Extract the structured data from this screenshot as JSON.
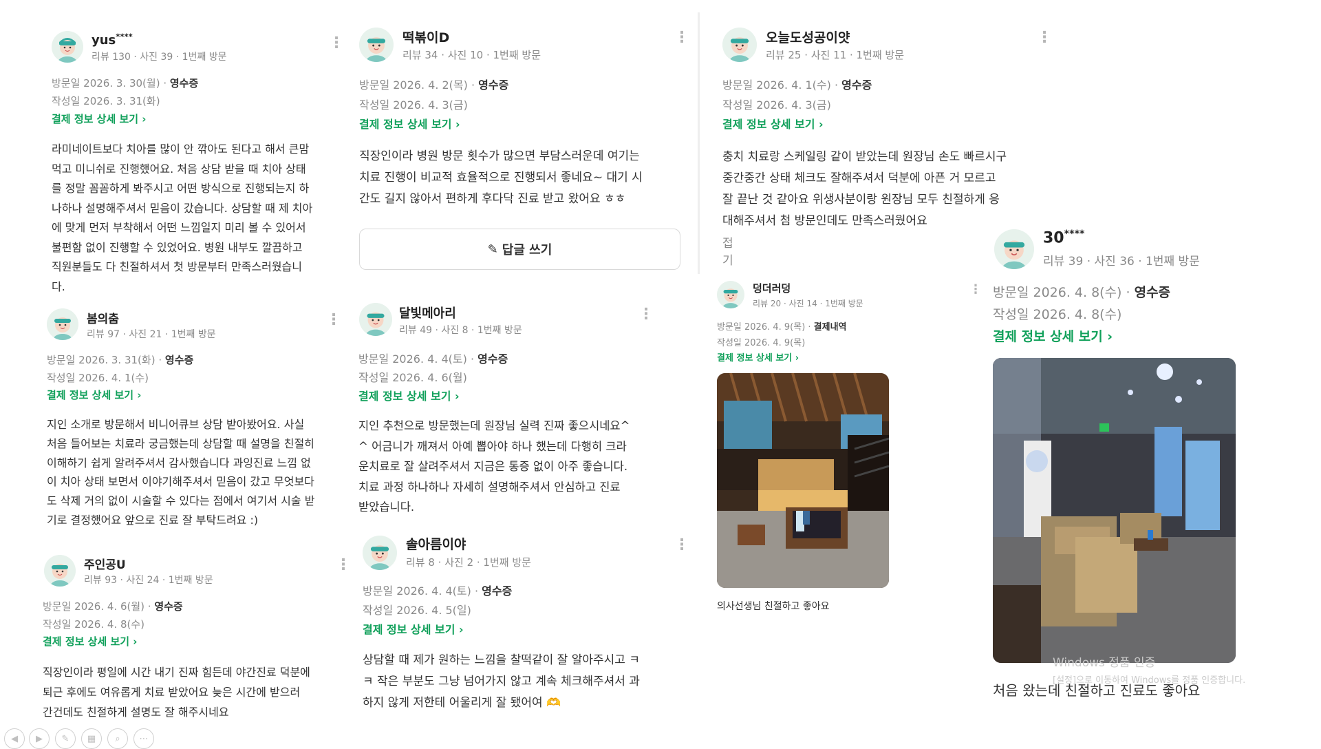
{
  "reviews": [
    {
      "name": "yus",
      "mask": "****",
      "stats": "리뷰 130 · 사진 39 · 1번째 방문",
      "visit_prefix": "방문일 2026. 3. 30(월) · ",
      "visit_tag": "영수증",
      "written": "작성일 2026. 3. 31(화)",
      "pay": "결제 정보 상세 보기 ›",
      "body": [
        "라미네이트보다 치아를 많이 안 깎아도 된다고 해서 큰맘",
        "먹고 미니쉬로 진행했어요. 처음 상담 받을 때 치아 상태",
        "를 정말 꼼꼼하게 봐주시고 어떤 방식으로 진행되는지 하",
        "나하나 설명해주셔서 믿음이 갔습니다. 상담할 때 제 치아",
        "에 맞게 먼저 부착해서 어떤 느낌일지 미리 볼 수 있어서",
        "불편함 없이 진행할 수 있었어요. 병원 내부도 깔끔하고",
        "직원분들도 다 친절하셔서 첫 방문부터 만족스러웠습니",
        "다."
      ]
    },
    {
      "name": "봄의춤",
      "stats": "리뷰 97 · 사진 21 · 1번째 방문",
      "visit_prefix": "방문일 2026. 3. 31(화) · ",
      "visit_tag": "영수증",
      "written": "작성일 2026. 4. 1(수)",
      "pay": "결제 정보 상세 보기 ›",
      "body": [
        "지인 소개로 방문해서 비니어큐브 상담 받아봤어요. 사실",
        "처음 들어보는 치료라 궁금했는데 상담할 때 설명을 친절히",
        "이해하기 쉽게 알려주셔서 감사했습니다 과잉진료 느낌 없",
        "이 치아 상태 보면서 이야기해주셔서 믿음이 갔고 무엇보다",
        "도 삭제 거의 없이 시술할 수 있다는 점에서 여기서 시술 받",
        "기로 결정했어요 앞으로 진료 잘 부탁드려요 :)"
      ]
    },
    {
      "name": "주인공U",
      "stats": "리뷰 93 · 사진 24 · 1번째 방문",
      "visit_prefix": "방문일 2026. 4. 6(월) · ",
      "visit_tag": "영수증",
      "written": "작성일 2026. 4. 8(수)",
      "pay": "결제 정보 상세 보기 ›",
      "body": [
        "직장인이라 평일에 시간 내기 진짜 힘든데 야간진료 덕분에",
        "퇴근 후에도 여유롭게 치료 받았어요 늦은 시간에 받으러",
        "간건데도 친절하게 설명도 잘 해주시네요"
      ]
    },
    {
      "name": "떡볶이D",
      "stats": "리뷰 34 · 사진 10 · 1번째 방문",
      "visit_prefix": "방문일 2026. 4. 2(목) · ",
      "visit_tag": "영수증",
      "written": "작성일 2026. 4. 3(금)",
      "pay": "결제 정보 상세 보기 ›",
      "body": [
        "직장인이라 병원 방문 횟수가 많으면 부담스러운데 여기는",
        "치료 진행이 비교적 효율적으로 진행되서 좋네요~ 대기 시",
        "간도 길지 않아서 편하게 후다닥 진료 받고 왔어요 ㅎㅎ"
      ],
      "reply": "답글 쓰기"
    },
    {
      "name": "달빛메아리",
      "stats": "리뷰 49 · 사진 8 · 1번째 방문",
      "visit_prefix": "방문일 2026. 4. 4(토) · ",
      "visit_tag": "영수증",
      "written": "작성일 2026. 4. 6(월)",
      "pay": "결제 정보 상세 보기 ›",
      "body": [
        "지인 추천으로 방문했는데 원장님 실력 진짜 좋으시네요^",
        "^ 어금니가 깨져서 아예 뽑아야 하나 했는데 다행히 크라",
        "운치료로 잘 살려주셔서 지금은 통증 없이 아주 좋습니다.",
        "치료 과정 하나하나 자세히 설명해주셔서 안심하고 진료",
        "받았습니다."
      ]
    },
    {
      "name": "솔아름이야",
      "stats": "리뷰 8 · 사진 2 · 1번째 방문",
      "visit_prefix": "방문일 2026. 4. 4(토) · ",
      "visit_tag": "영수증",
      "written": "작성일 2026. 4. 5(일)",
      "pay": "결제 정보 상세 보기 ›",
      "body": [
        "상담할 때 제가 원하는 느낌을 찰떡같이 잘 알아주시고 ㅋ",
        "ㅋ 작은 부분도 그냥 넘어가지 않고 계속 체크해주셔서 과",
        "하지 않게 저한테 어울리게 잘 됐어여"
      ]
    },
    {
      "name": "오늘도성공이얏",
      "stats": "리뷰 25 · 사진 11 · 1번째 방문",
      "visit_prefix": "방문일 2026. 4. 1(수) · ",
      "visit_tag": "영수증",
      "written": "작성일 2026. 4. 3(금)",
      "pay": "결제 정보 상세 보기 ›",
      "body": [
        "충치 치료랑 스케일링 같이 받았는데 원장님 손도 빠르시구",
        "중간중간 상태 체크도 잘해주셔서 덕분에 아픈 거 모르고",
        "잘 끝난 것 같아요 위생사분이랑 원장님 모두 친절하게 응",
        "대해주셔서 첨 방문인데도 만족스러웠어요"
      ],
      "fold": "접기"
    },
    {
      "name": "덩더러덩",
      "stats": "리뷰 20 · 사진 14 · 1번째 방문",
      "visit_prefix": "방문일 2026. 4. 9(목) · ",
      "visit_tag": "결제내역",
      "written": "작성일 2026. 4. 9(목)",
      "pay": "결제 정보 상세 보기 ›",
      "body": [
        "의사선생님 친절하고 좋아요"
      ]
    },
    {
      "name": "30",
      "mask": "****",
      "stats": "리뷰 39 · 사진 36 · 1번째 방문",
      "visit_prefix": "방문일 2026. 4. 8(수) · ",
      "visit_tag": "영수증",
      "written": "작성일 2026. 4. 8(수)",
      "pay": "결제 정보 상세 보기 ›",
      "body": [
        "처음 왔는데 친절하고 진료도 좋아요"
      ]
    }
  ],
  "icons": {
    "more": "more-vertical-icon",
    "pencil": "pencil-icon",
    "avatar": "avatar-icon"
  },
  "windows_watermark": {
    "line1": "Windows 정품 인증",
    "line2": "[설정]으로 이동하여 Windows를 정품 인증합니다."
  },
  "colors": {
    "accent_green": "#10a05a",
    "text": "#333333",
    "muted": "#8a8a8a"
  }
}
